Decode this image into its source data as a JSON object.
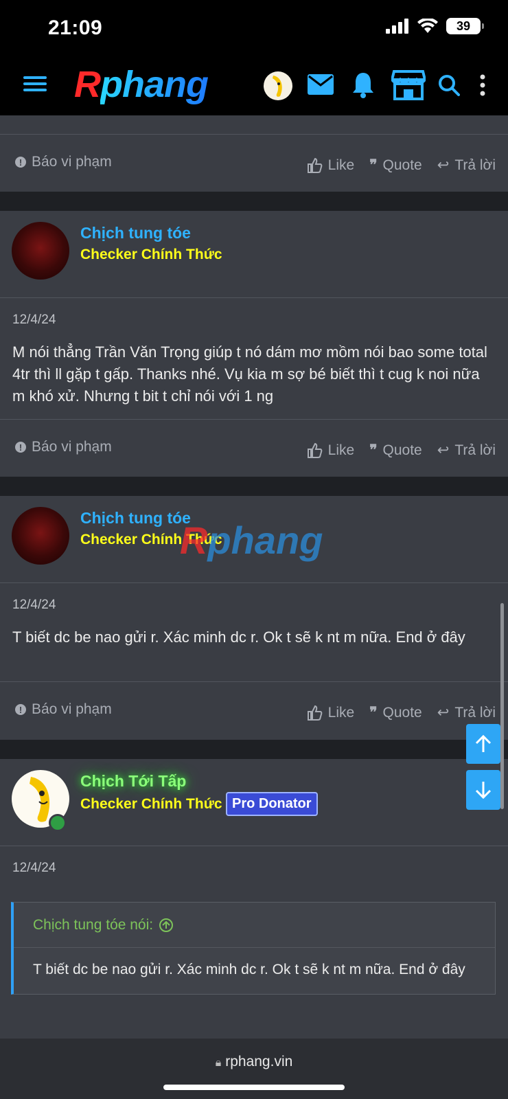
{
  "status": {
    "time": "21:09",
    "battery": "39"
  },
  "header": {
    "logo_r": "R",
    "logo_rest": "phang"
  },
  "posts_top": {
    "report": "Báo vi phạm",
    "like": "Like",
    "quote": "Quote",
    "reply": "Trả lời"
  },
  "post1": {
    "username": "Chịch tung tóe",
    "rank": "Checker Chính Thức",
    "date": "12/4/24",
    "body": "M nói thẳng Trần Văn Trọng giúp t nó dám mơ mồm nói bao some total 4tr thì ll gặp t gấp. Thanks nhé. Vụ kia m sợ bé biết thì t cug k noi nữa m khó xử. Nhưng t bit t chỉ nói với 1 ng",
    "report": "Báo vi phạm",
    "like": "Like",
    "quote": "Quote",
    "reply": "Trả lời"
  },
  "post2": {
    "username": "Chịch tung tóe",
    "rank": "Checker Chính Thức",
    "date": "12/4/24",
    "body": "T biết dc be nao gửi r. Xác minh dc r. Ok t sẽ k nt m nữa. End ở đây",
    "report": "Báo vi phạm",
    "like": "Like",
    "quote": "Quote",
    "reply": "Trả lời"
  },
  "post3": {
    "username": "Chịch Tới Tấp",
    "rank": "Checker Chính Thức",
    "badge": "Pro Donator",
    "date": "12/4/24",
    "quote_author": "Chịch tung tóe nói:",
    "quote_body": "T biết dc be nao gửi r. Xác minh dc r. Ok t sẽ k nt m nữa. End ở đây"
  },
  "watermark": {
    "r": "R",
    "rest": "phang"
  },
  "browser": {
    "url": "rphang.vin"
  },
  "colors": {
    "accent": "#2fb2ff",
    "rank": "#ffff1a",
    "online": "#2f9e44",
    "badge": "#3a4bd6"
  }
}
